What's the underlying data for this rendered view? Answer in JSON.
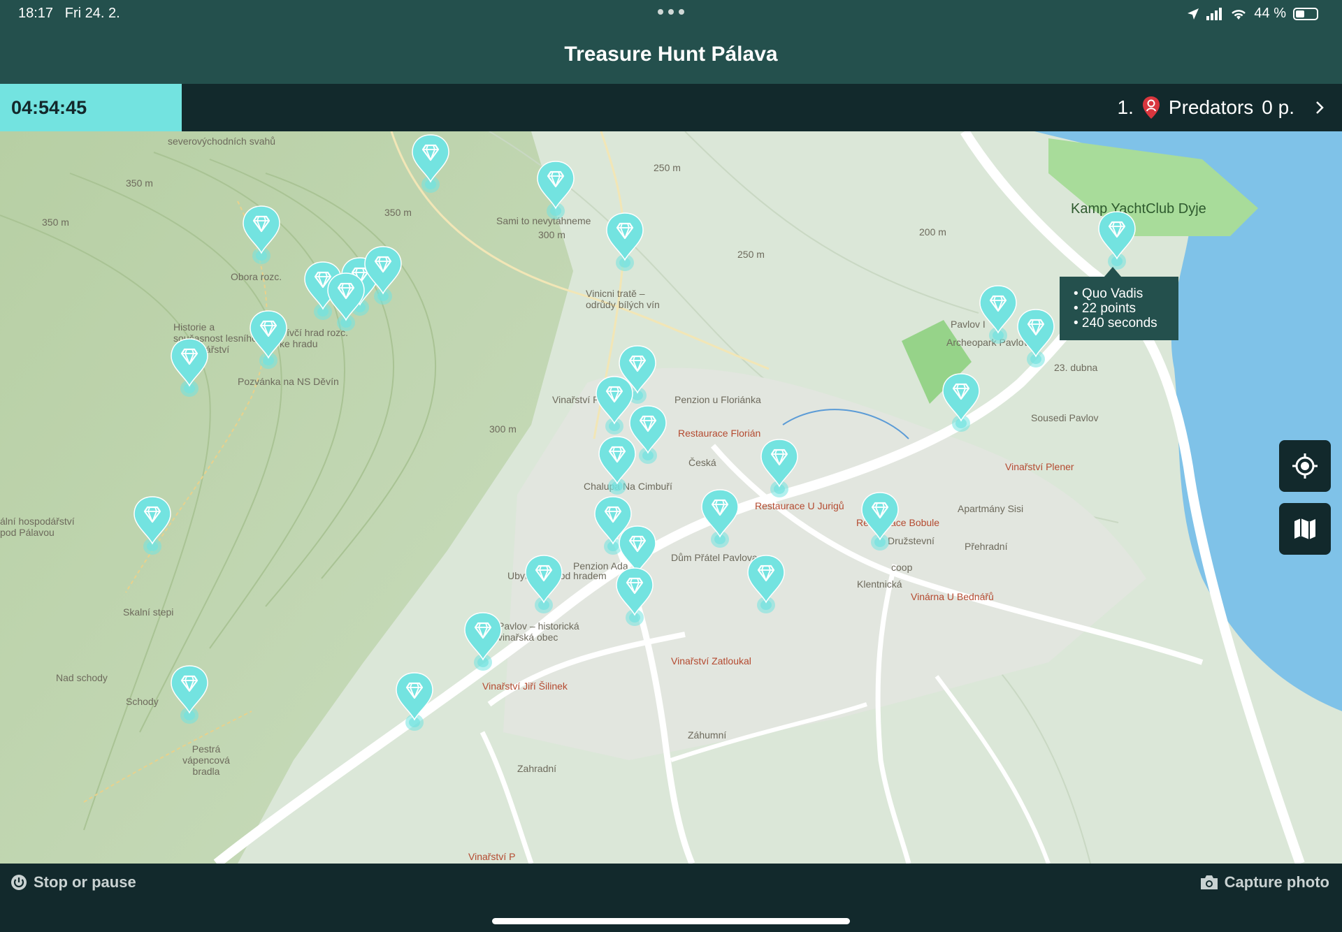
{
  "status_bar": {
    "time": "18:17",
    "date": "Fri 24. 2.",
    "battery": "44 %",
    "battery_level": 0.44,
    "icons": [
      "location-arrow-icon",
      "signal-icon",
      "wifi-icon",
      "battery-icon"
    ]
  },
  "header": {
    "title": "Treasure Hunt Pálava"
  },
  "info_bar": {
    "timer": "04:54:45",
    "rank": "1.",
    "team": "Predators",
    "points": "0 p.",
    "team_color": "#d9363e"
  },
  "tooltip": {
    "lines": [
      "• Quo Vadis",
      "• 22 points",
      "• 240 seconds"
    ]
  },
  "map_labels": [
    "severovýchodních svahů",
    "350 m",
    "350 m",
    "350 m",
    "300 m",
    "300 m",
    "250 m",
    "250 m",
    "200 m",
    "Sami to nevytáhneme",
    "Obora rozc.",
    "Vinicni tratě – odrůdy bílých vín",
    "Dívčí hrad rozc. ke hradu",
    "Historie a současnost lesního hospodářství",
    "Pozvánka na NS Děvín",
    "Vinařství P",
    "Penzion u Floriánka",
    "Restaurace Florián",
    "Česká",
    "Chalupa Na Cimbuří",
    "Restaurace U Jurigů",
    "Restaurace Bobule",
    "Pavlov I",
    "Archeopark Pavlov",
    "23. dubna",
    "Sousedi Pavlov",
    "Vinařství Plener",
    "Přehradní",
    "Apartmány Sisi",
    "Družstevní",
    "coop",
    "Dům Přátel Pavlova",
    "Penzion Ada",
    "Ubytování pod hradem",
    "Pavlov – historická vinařská obec",
    "Vinařství Jiří Šilinek",
    "Vinařství Zatloukal",
    "Vinárna U Bednářů",
    "Kamp YachtClub Dyje",
    "Skalní stepi",
    "Nad schody",
    "Schody",
    "Pestrá vápencová bradla",
    "Zahradní",
    "Záhumní",
    "Klentnická",
    "Vinařství P",
    "ální hospodářství pod Pálavou"
  ],
  "map_buttons": {
    "locate": "crosshair-icon",
    "layers": "map-icon"
  },
  "bottom_bar": {
    "stop_label": "Stop or pause",
    "photo_label": "Capture photo"
  },
  "colors": {
    "header": "#24504d",
    "dark": "#12292c",
    "accent": "#73e3e0",
    "water": "#7fc2e8"
  }
}
